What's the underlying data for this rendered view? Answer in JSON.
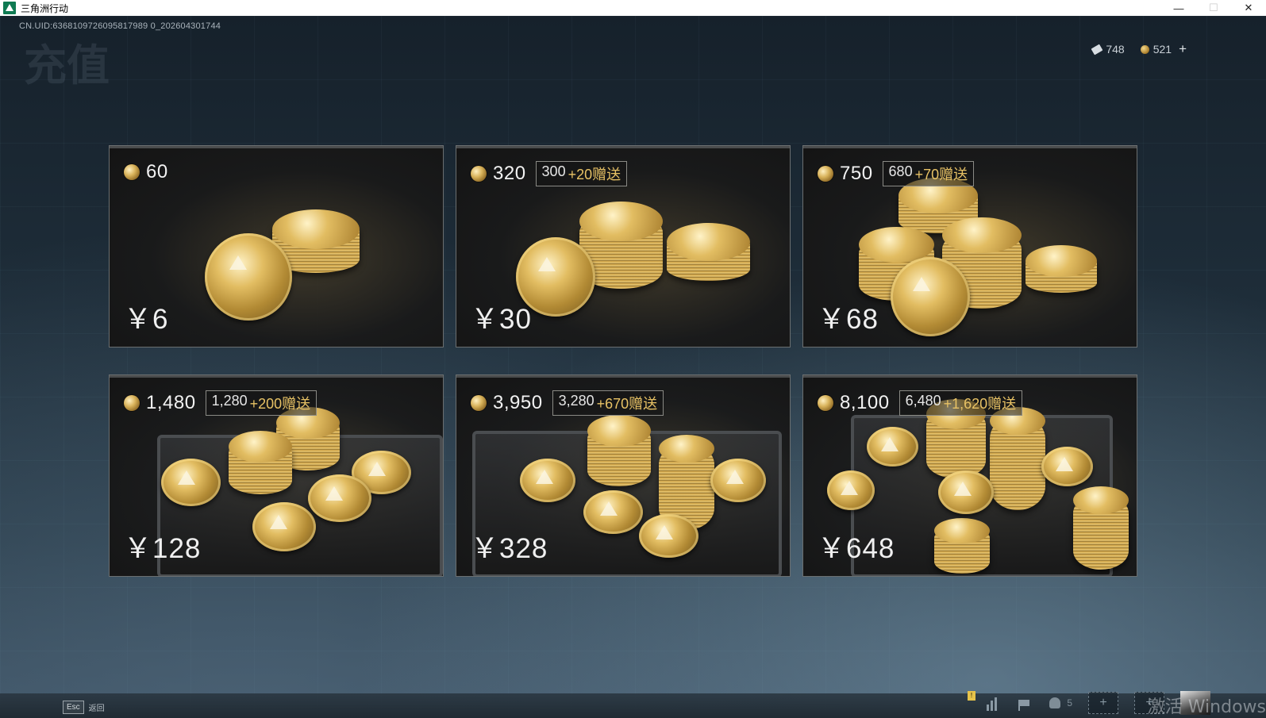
{
  "window": {
    "title": "三角洲行动",
    "minimize": "—",
    "maximize": "☐",
    "close": "✕"
  },
  "header": {
    "uid": "CN.UID:6368109726095817989 0_202604301744",
    "page_title": "充值"
  },
  "currency": {
    "tickets": "748",
    "coins": "521",
    "add": "+"
  },
  "packs": [
    {
      "amount": "60",
      "base": "",
      "bonus": "",
      "price": "￥6"
    },
    {
      "amount": "320",
      "base": "300",
      "bonus": "+20赠送",
      "price": "￥30"
    },
    {
      "amount": "750",
      "base": "680",
      "bonus": "+70赠送",
      "price": "￥68"
    },
    {
      "amount": "1,480",
      "base": "1,280",
      "bonus": "+200赠送",
      "price": "￥128"
    },
    {
      "amount": "3,950",
      "base": "3,280",
      "bonus": "+670赠送",
      "price": "￥328"
    },
    {
      "amount": "8,100",
      "base": "6,480",
      "bonus": "+1,620赠送",
      "price": "￥648"
    }
  ],
  "footer": {
    "esc_key": "Esc",
    "esc_label": "返回",
    "friends_count": "5",
    "slot_plus": "+",
    "notification": "!",
    "watermark": "激活 Windows"
  },
  "colors": {
    "bonus_gold": "#e8c265",
    "background": "#1e2d39"
  }
}
